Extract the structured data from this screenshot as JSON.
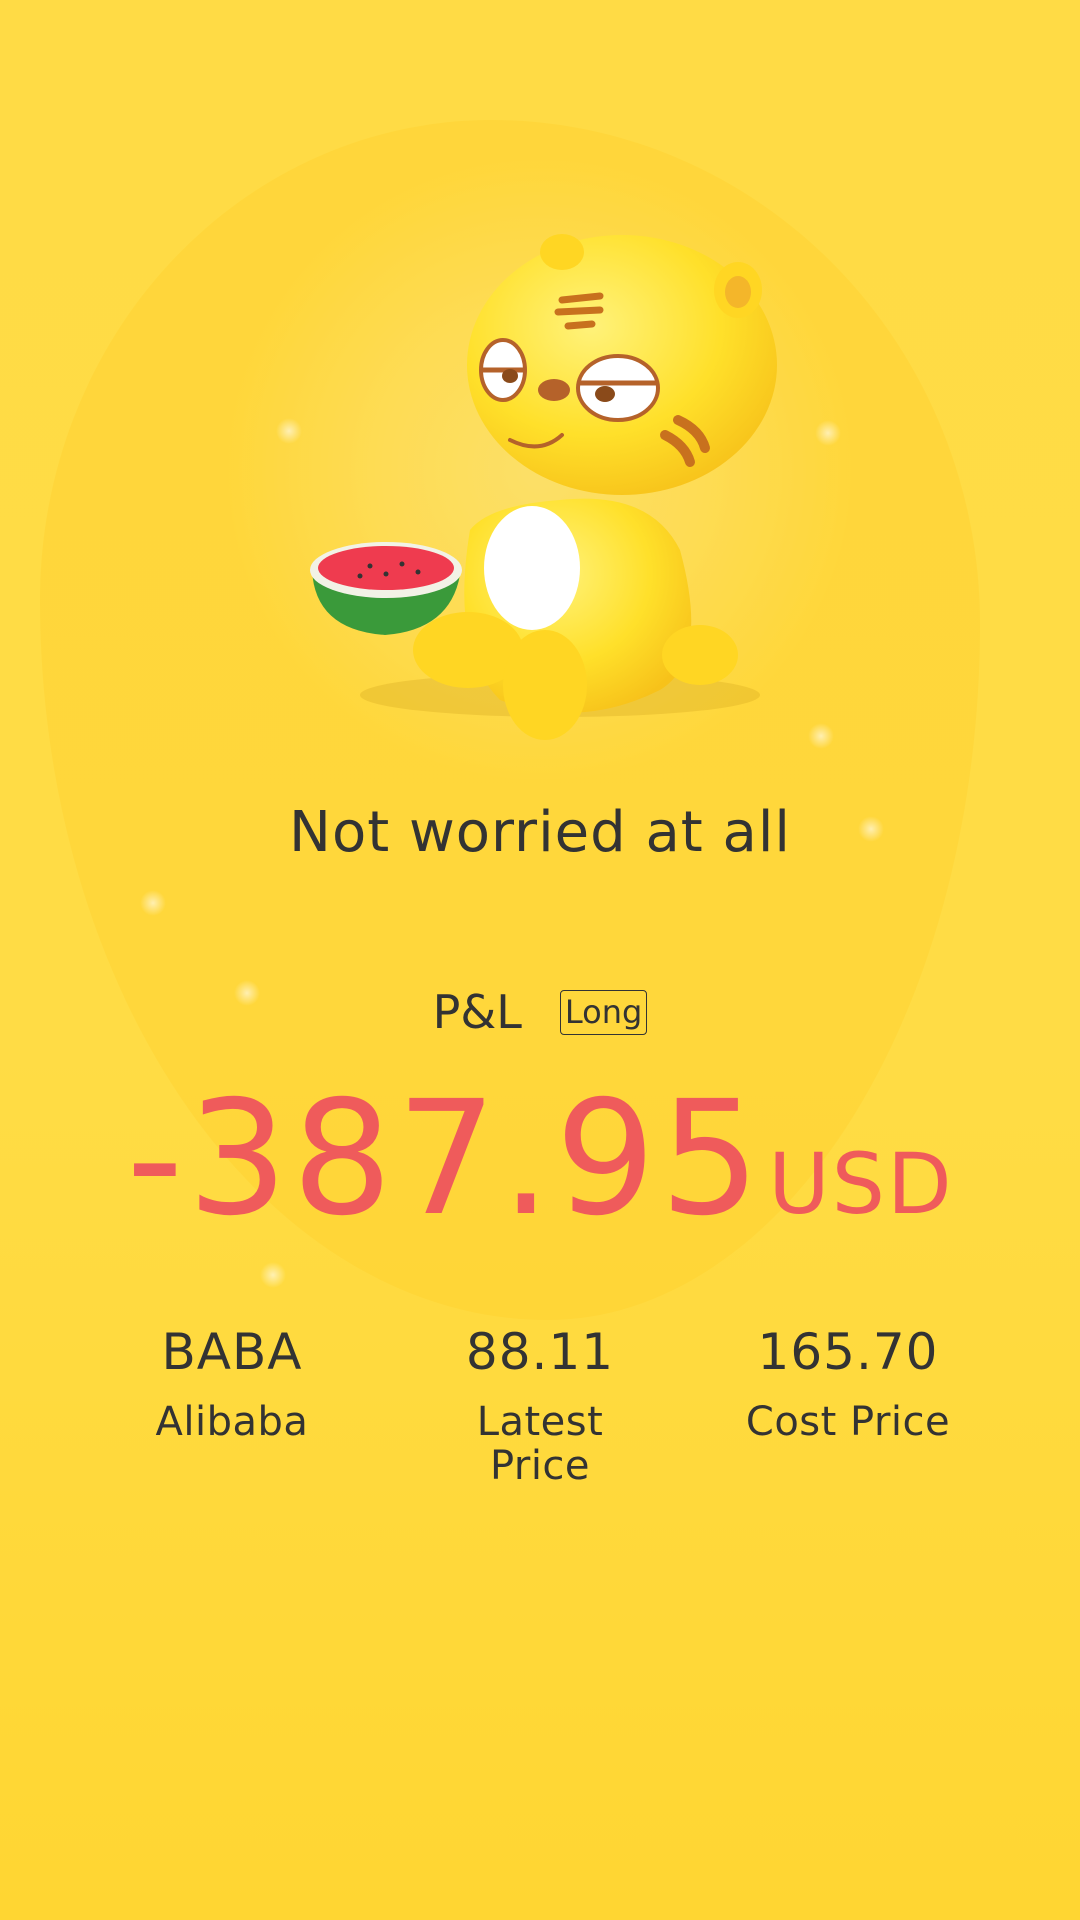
{
  "mood_text": "Not worried at all",
  "pl": {
    "label": "P&L",
    "position": "Long",
    "amount": "-387.95",
    "currency": "USD",
    "amount_color": "#ef5b5b"
  },
  "stats": [
    {
      "value": "BABA",
      "label": "Alibaba"
    },
    {
      "value": "88.11",
      "label": "Latest Price"
    },
    {
      "value": "165.70",
      "label": "Cost Price"
    }
  ],
  "colors": {
    "background": "#ffd83a",
    "text": "#333333",
    "loss": "#ef5b5b"
  },
  "illustration": "tiger-mascot-with-watermelon-icon"
}
